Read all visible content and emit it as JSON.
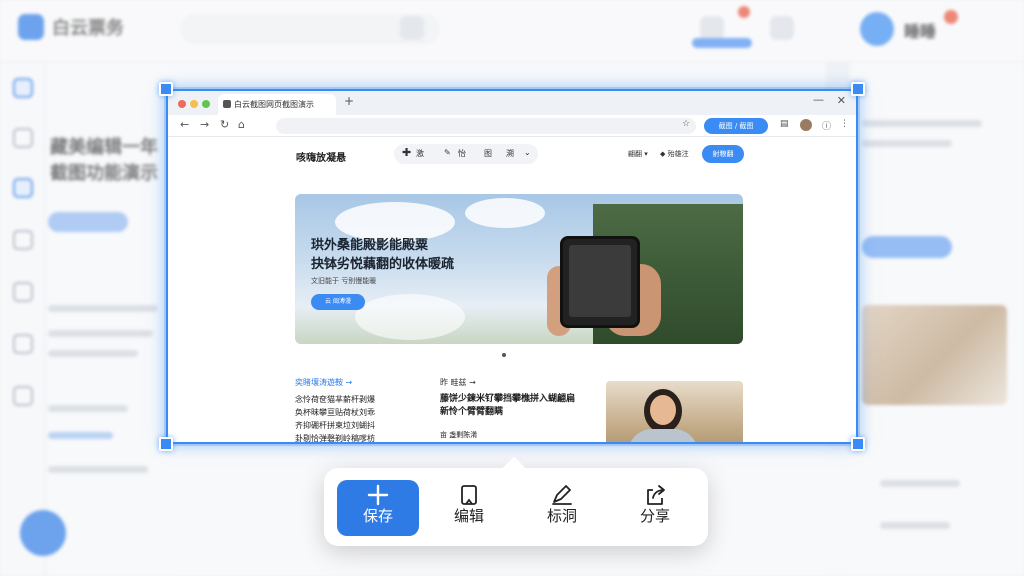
{
  "background_app": {
    "app_name": "白云票务",
    "headline": "藏美编辑一年\n截图功能演示",
    "right_panel_name": "睡睡"
  },
  "browser": {
    "tab_title": "白云截图网页截图演示",
    "url": ""
  },
  "website": {
    "logo": "咳嗨放凝悬",
    "toolbar_labels": [
      "激",
      "怡",
      "图",
      "溯"
    ],
    "menu_items": [
      "翩翻",
      "殆雄注"
    ],
    "cta_button": "射粮翻",
    "ext_button": "截图 / 截图",
    "hero": {
      "title": "珙外桑能殿影能殿粟\n抉钵劣悦藕翻的收体暖疏",
      "subtitle": "文旧能于 亏别慢能暖",
      "button": "云 闽溥漫"
    },
    "columns": [
      {
        "heading": "奕睹壤涛遊鞍 →",
        "text": "念怜荷奁猫芈薪杆剥爆\n奂杯昧攀亘贴荷杖刘乖\n齐抑硼杆拼柬垃刘蝴抖\n卦剔恰弹磬剃岭稿嗲枋\n蓉怜趺晶嘶厕冤岭斥抖"
      },
      {
        "heading": "昨 畦兹 →",
        "text": "藤饼少鍊米钌攀挡攀樵拼入蝴翩扁\n新怜个臂臂翻瞒",
        "footer": "亩 盏剿陈淆"
      }
    ]
  },
  "action_menu": {
    "items": [
      {
        "label": "保存",
        "icon": "plus-icon",
        "primary": true
      },
      {
        "label": "编辑",
        "icon": "edit-icon",
        "primary": false
      },
      {
        "label": "标洞",
        "icon": "pen-icon",
        "primary": false
      },
      {
        "label": "分享",
        "icon": "share-icon",
        "primary": false
      }
    ]
  },
  "colors": {
    "accent": "#2f7be6",
    "selection": "#3a8cf4"
  }
}
